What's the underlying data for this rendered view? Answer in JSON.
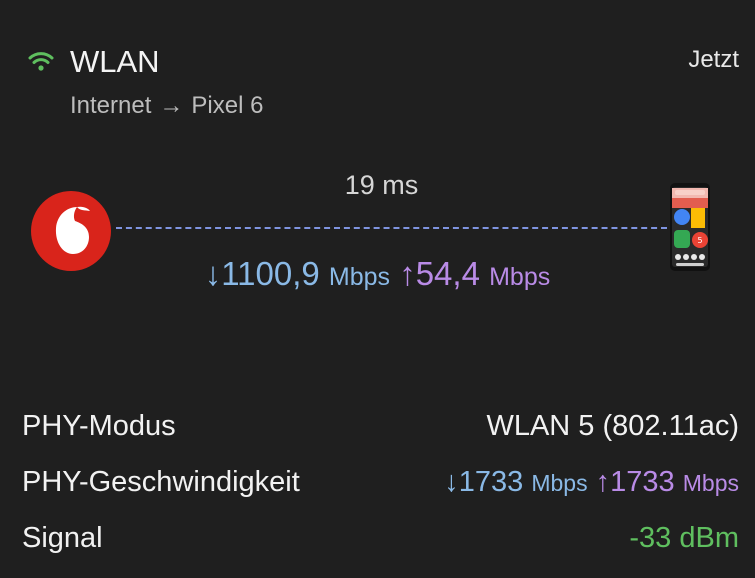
{
  "header": {
    "title": "WLAN",
    "time": "Jetzt",
    "route_from": "Internet",
    "route_arrow": "→",
    "route_to": "Pixel 6"
  },
  "diagram": {
    "latency": "19 ms",
    "download_arrow": "↓",
    "download_value": "1100,9",
    "download_unit": "Mbps",
    "upload_arrow": "↑",
    "upload_value": "54,4",
    "upload_unit": "Mbps",
    "isp_logo": "vodafone-logo",
    "device_image": "pixel-phone"
  },
  "details": {
    "phy_mode_label": "PHY-Modus",
    "phy_mode_value": "WLAN 5 (802.11ac)",
    "phy_speed_label": "PHY-Geschwindigkeit",
    "phy_speed_down_arrow": "↓",
    "phy_speed_down": "1733",
    "phy_speed_down_unit": "Mbps",
    "phy_speed_up_arrow": "↑",
    "phy_speed_up": "1733",
    "phy_speed_up_unit": "Mbps",
    "signal_label": "Signal",
    "signal_value": "-33 dBm"
  },
  "colors": {
    "background": "#1f1f1f",
    "download": "#8ab9e6",
    "upload": "#b98be6",
    "signal_good": "#5fbf5f",
    "wifi_icon": "#5fbf5f",
    "dashed_line": "#7f94e0"
  }
}
